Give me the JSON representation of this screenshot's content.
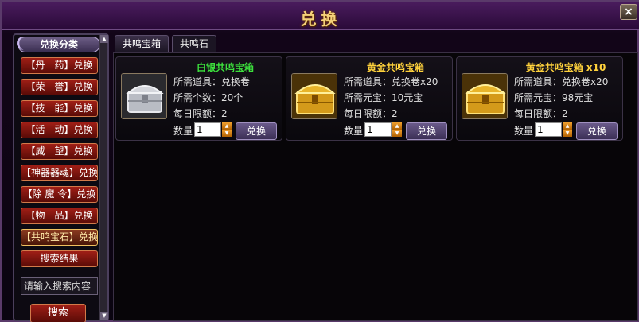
{
  "window": {
    "title": "兑换",
    "close_label": "×"
  },
  "sidebar": {
    "header": "兑换分类",
    "items": [
      {
        "label": "【丹　药】兑换",
        "active": false
      },
      {
        "label": "【荣　誉】兑换",
        "active": false
      },
      {
        "label": "【技　能】兑换",
        "active": false
      },
      {
        "label": "【活　动】兑换",
        "active": false
      },
      {
        "label": "【威　望】兑换",
        "active": false
      },
      {
        "label": "【神器器魂】兑换",
        "active": false
      },
      {
        "label": "【除 魔 令】兑换",
        "active": false
      },
      {
        "label": "【物　品】兑换",
        "active": false
      },
      {
        "label": "【共鸣宝石】兑换",
        "active": true
      },
      {
        "label": "搜索结果",
        "active": false
      }
    ],
    "search_placeholder": "请输入搜索内容",
    "search_button": "搜索"
  },
  "tabs": [
    {
      "label": "共鸣宝箱",
      "active": true
    },
    {
      "label": "共鸣石",
      "active": false
    }
  ],
  "cards": [
    {
      "title": "白银共鸣宝箱",
      "title_color": "#3ce03c",
      "icon": "silver-chest-icon",
      "line1": "所需道具：兑换卷",
      "line2": "所需个数：20个",
      "line3": "每日限额：2",
      "qty_label": "数量",
      "qty_value": "1",
      "button": "兑换"
    },
    {
      "title": "黄金共鸣宝箱",
      "title_color": "#ffd23c",
      "icon": "gold-chest-icon",
      "line1": "所需道具：兑换卷x20",
      "line2": "所需元宝：10元宝",
      "line3": "每日限额：2",
      "qty_label": "数量",
      "qty_value": "1",
      "button": "兑换"
    },
    {
      "title": "黄金共鸣宝箱 x10",
      "title_color": "#ffd23c",
      "icon": "gold-chest-icon",
      "line1": "所需道具：兑换卷x20",
      "line2": "所需元宝：98元宝",
      "line3": "每日限额：2",
      "qty_label": "数量",
      "qty_value": "1",
      "button": "兑换"
    }
  ]
}
